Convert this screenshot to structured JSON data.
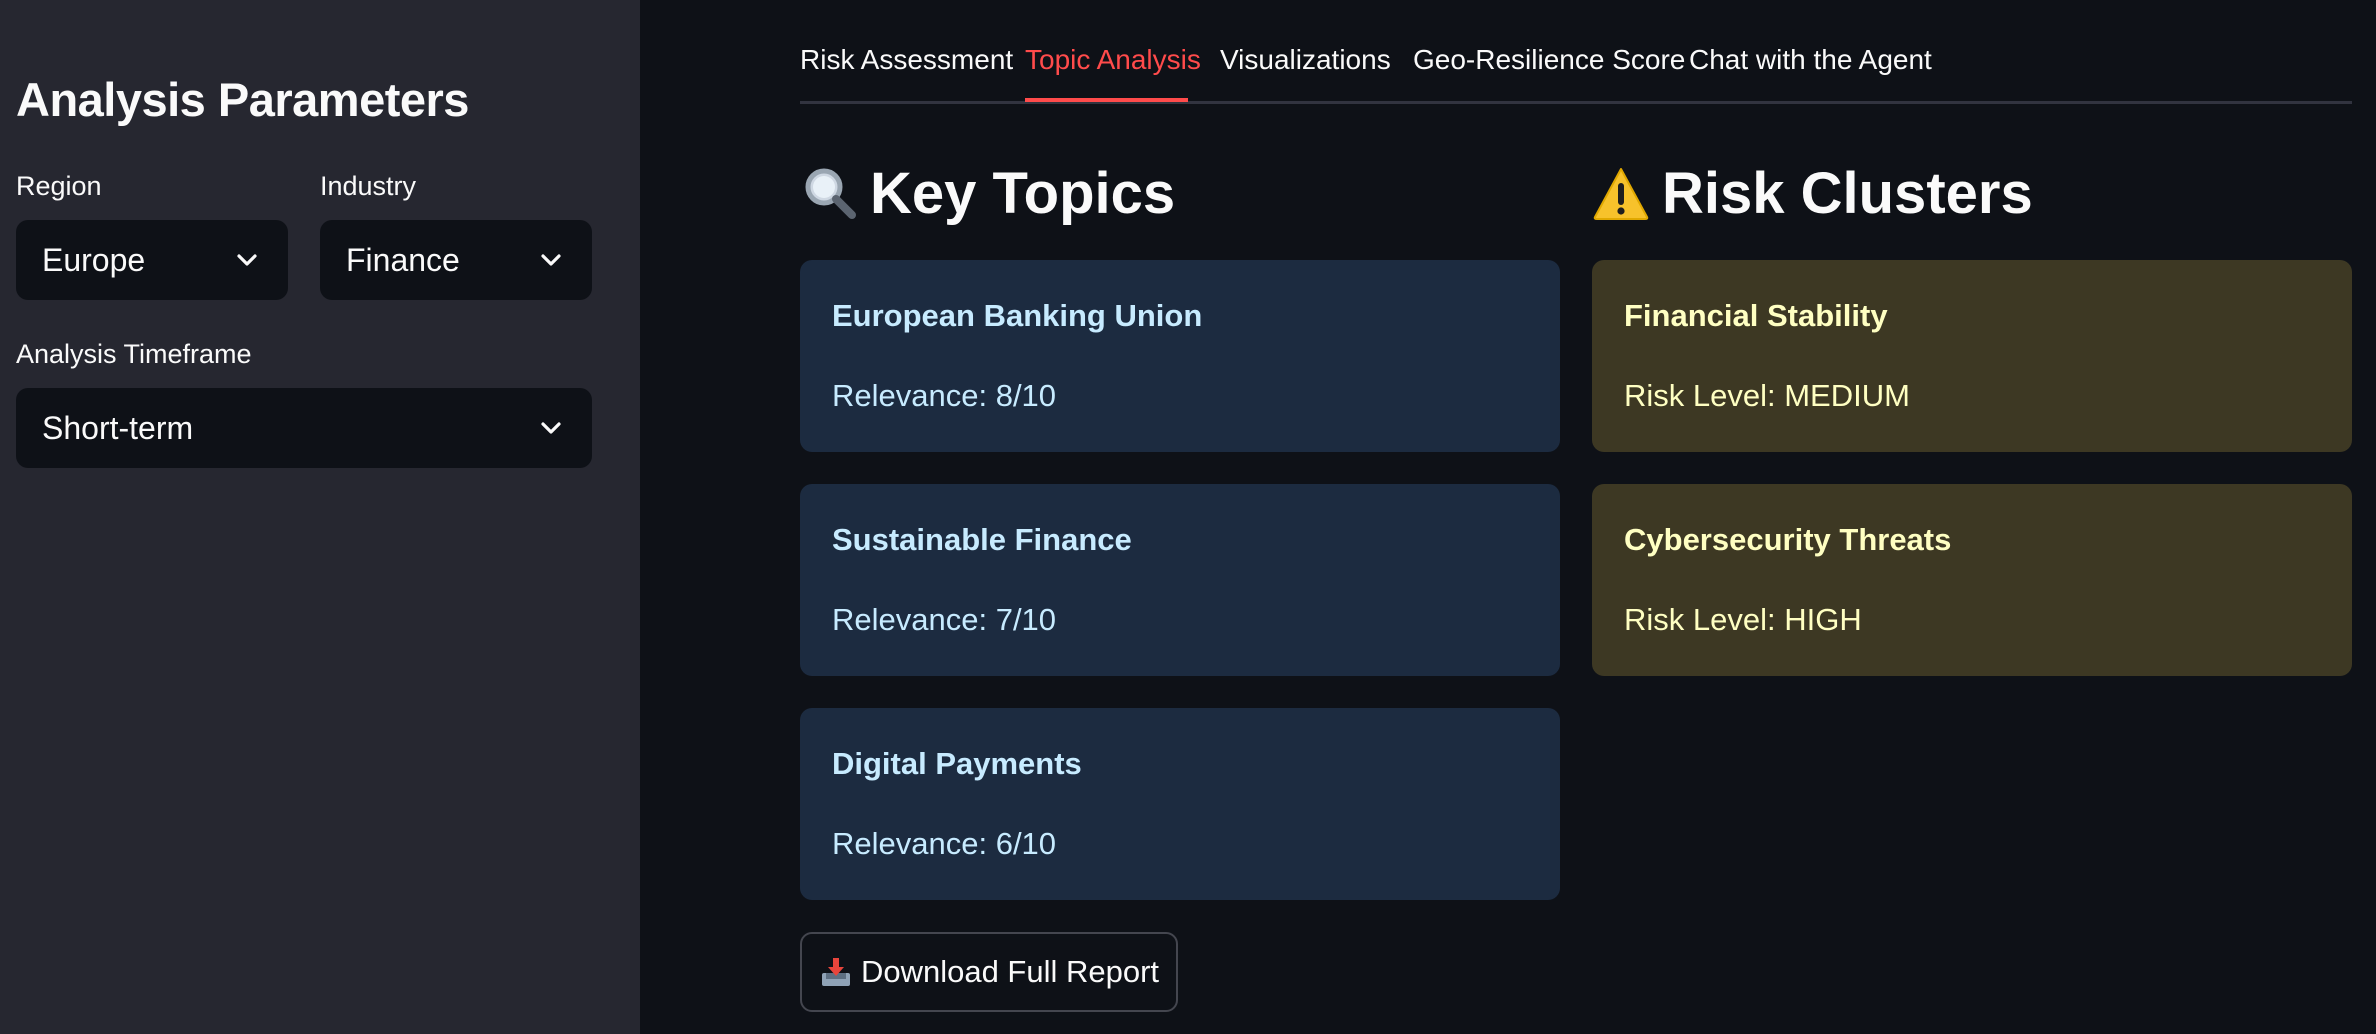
{
  "sidebar": {
    "title": "Analysis Parameters",
    "region": {
      "label": "Region",
      "value": "Europe"
    },
    "industry": {
      "label": "Industry",
      "value": "Finance"
    },
    "timeframe": {
      "label": "Analysis Timeframe",
      "value": "Short-term"
    }
  },
  "tabs": [
    {
      "label": "Risk Assessment",
      "active": false
    },
    {
      "label": "Topic Analysis",
      "active": true
    },
    {
      "label": "Visualizations",
      "active": false
    },
    {
      "label": "Geo-Resilience Score",
      "active": false
    },
    {
      "label": "Chat with the Agent",
      "active": false
    }
  ],
  "key_topics": {
    "title": "Key Topics",
    "icon": "magnifying-glass-icon",
    "items": [
      {
        "name": "European Banking Union",
        "relevance": "Relevance: 8/10"
      },
      {
        "name": "Sustainable Finance",
        "relevance": "Relevance: 7/10"
      },
      {
        "name": "Digital Payments",
        "relevance": "Relevance: 6/10"
      }
    ]
  },
  "risk_clusters": {
    "title": "Risk Clusters",
    "icon": "warning-icon",
    "items": [
      {
        "name": "Financial Stability",
        "level": "Risk Level: MEDIUM"
      },
      {
        "name": "Cybersecurity Threats",
        "level": "Risk Level: HIGH"
      }
    ]
  },
  "download": {
    "label": "Download Full Report",
    "icon": "inbox-tray-icon"
  },
  "colors": {
    "background": "#0e1117",
    "sidebar": "#262730",
    "accent": "#ff4b4b",
    "topic_card": "#1c2b40",
    "risk_card": "#3d3823"
  }
}
